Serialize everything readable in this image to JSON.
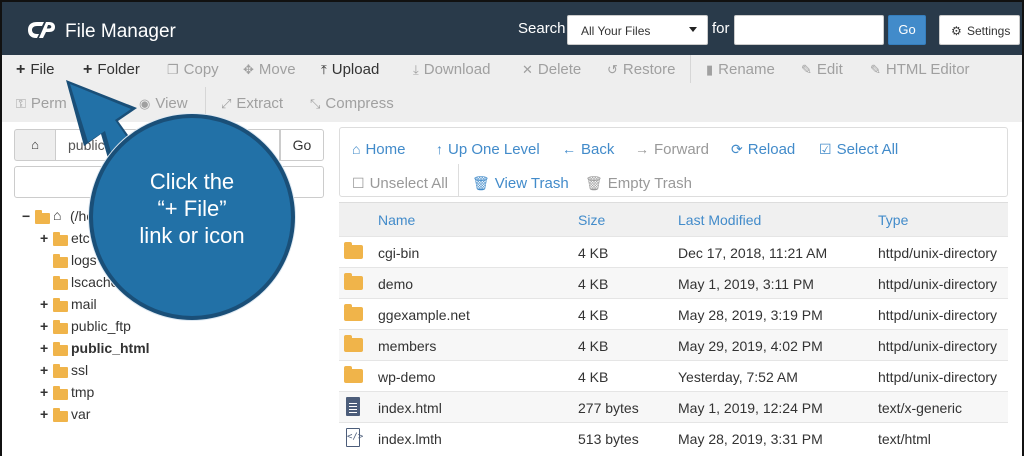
{
  "header": {
    "app_title": "File Manager",
    "search_label": "Search",
    "search_scope": "All Your Files",
    "for_label": "for",
    "search_value": "",
    "go_label": "Go",
    "settings_label": "Settings"
  },
  "toolbar": {
    "file": "File",
    "folder": "Folder",
    "copy": "Copy",
    "move": "Move",
    "upload": "Upload",
    "download": "Download",
    "delete": "Delete",
    "restore": "Restore",
    "rename": "Rename",
    "edit": "Edit",
    "html_editor": "HTML Editor",
    "permissions": "Perm",
    "view": "View",
    "extract": "Extract",
    "compress": "Compress"
  },
  "left": {
    "path_value": "public",
    "go_label": "Go",
    "tree": [
      {
        "toggle": "−",
        "label": "(/ho",
        "bold": false
      },
      {
        "toggle": "+",
        "label": "etc",
        "bold": false
      },
      {
        "toggle": "",
        "label": "logs",
        "bold": false
      },
      {
        "toggle": "",
        "label": "lscache",
        "bold": false
      },
      {
        "toggle": "+",
        "label": "mail",
        "bold": false
      },
      {
        "toggle": "+",
        "label": "public_ftp",
        "bold": false
      },
      {
        "toggle": "+",
        "label": "public_html",
        "bold": true
      },
      {
        "toggle": "+",
        "label": "ssl",
        "bold": false
      },
      {
        "toggle": "+",
        "label": "tmp",
        "bold": false
      },
      {
        "toggle": "+",
        "label": "var",
        "bold": false
      }
    ]
  },
  "nav": {
    "home": "Home",
    "up_one_level": "Up One Level",
    "back": "Back",
    "forward": "Forward",
    "reload": "Reload",
    "select_all": "Select All",
    "unselect_all": "Unselect All",
    "view_trash": "View Trash",
    "empty_trash": "Empty Trash"
  },
  "table": {
    "headers": {
      "name": "Name",
      "size": "Size",
      "modified": "Last Modified",
      "type": "Type"
    },
    "rows": [
      {
        "icon": "folder",
        "name": "cgi-bin",
        "size": "4 KB",
        "modified": "Dec 17, 2018, 11:21 AM",
        "type": "httpd/unix-directory"
      },
      {
        "icon": "folder",
        "name": "demo",
        "size": "4 KB",
        "modified": "May 1, 2019, 3:11 PM",
        "type": "httpd/unix-directory"
      },
      {
        "icon": "folder",
        "name": "ggexample.net",
        "size": "4 KB",
        "modified": "May 28, 2019, 3:19 PM",
        "type": "httpd/unix-directory"
      },
      {
        "icon": "folder",
        "name": "members",
        "size": "4 KB",
        "modified": "May 29, 2019, 4:02 PM",
        "type": "httpd/unix-directory"
      },
      {
        "icon": "folder",
        "name": "wp-demo",
        "size": "4 KB",
        "modified": "Yesterday, 7:52 AM",
        "type": "httpd/unix-directory"
      },
      {
        "icon": "document",
        "name": "index.html",
        "size": "277 bytes",
        "modified": "May 1, 2019, 12:24 PM",
        "type": "text/x-generic"
      },
      {
        "icon": "code",
        "name": "index.lmth",
        "size": "513 bytes",
        "modified": "May 28, 2019, 3:31 PM",
        "type": "text/html"
      }
    ]
  },
  "callout": {
    "line1": "Click the",
    "line2": "“+ File”",
    "line3": "link or icon"
  },
  "colors": {
    "header_bg": "#293a4a",
    "link_blue": "#428bca",
    "folder_orange": "#f0b44a",
    "callout_blue": "#2271a7"
  }
}
